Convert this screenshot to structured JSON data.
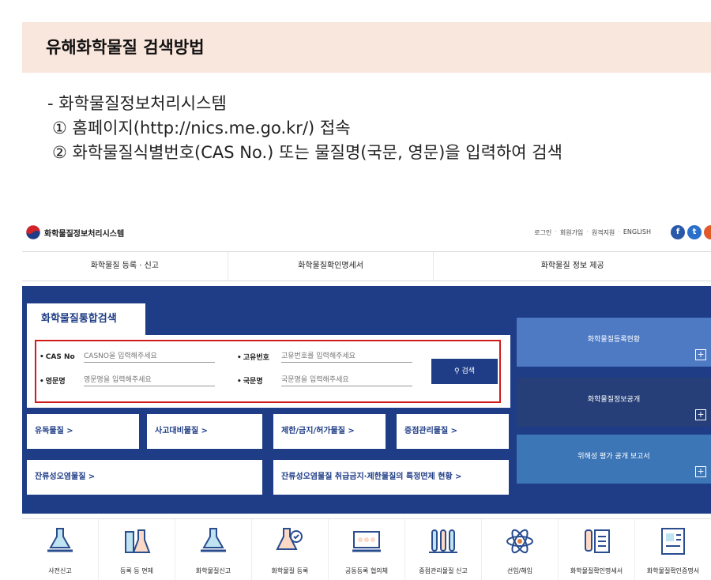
{
  "doc": {
    "title": "유해화학물질 검색방법",
    "line1": "- 화학물질정보처리시스템",
    "line2": "① 홈페이지(http://nics.me.go.kr/) 접속",
    "line3": "② 화학물질식별번호(CAS No.) 또는 물질명(국문, 영문)을 입력하여 검색"
  },
  "site": {
    "logo_text": "화학물질정보처리시스템",
    "util": [
      "로그인",
      "회원가입",
      "원격지원",
      "ENGLISH"
    ],
    "sns": [
      "f",
      "t"
    ],
    "gnb": [
      "화학물질 등록 · 신고",
      "화학물질확인명세서",
      "화학물질 정보 제공"
    ],
    "search": {
      "tab": "화학물질통합검색",
      "cas_label": "CAS No",
      "cas_placeholder": "CASNO을 입력해주세요",
      "unique_label": "고유번호",
      "unique_placeholder": "고유번호를 입력해주세요",
      "eng_label": "영문명",
      "eng_placeholder": "영문명을 입력해주세요",
      "kor_label": "국문명",
      "kor_placeholder": "국문명을 입력해주세요",
      "button": "검색"
    },
    "quick": [
      "유독물질 >",
      "사고대비물질 >",
      "제한/금지/허가물질 >",
      "중점관리물질 >",
      "잔류성오염물질 >",
      "잔류성오염물질 취급금지·제한물질의 특정면제 현황 >"
    ],
    "side": [
      "화학물질등록현황",
      "화학물질정보공개",
      "위해성 평가 공개 보고서"
    ],
    "icons": [
      {
        "label": "사전신고",
        "icon": "flask-hand-icon"
      },
      {
        "label": "등록 등 면제",
        "icon": "beakers-icon"
      },
      {
        "label": "화학물질신고",
        "icon": "flask-hand-icon"
      },
      {
        "label": "화학물질 등록",
        "icon": "flask-check-icon"
      },
      {
        "label": "공동등록 협의체",
        "icon": "group-screen-icon"
      },
      {
        "label": "중점관리물질 신고",
        "icon": "test-tubes-icon"
      },
      {
        "label": "선임/해임",
        "icon": "atom-icon"
      },
      {
        "label": "화학물질확인명세서",
        "icon": "tube-document-icon"
      },
      {
        "label": "화학물질확인증명서",
        "icon": "certificate-icon"
      }
    ],
    "colors": {
      "navy": "#1f3d86",
      "highlight_border": "#d21c1c",
      "band": "#f9e6dc"
    }
  }
}
